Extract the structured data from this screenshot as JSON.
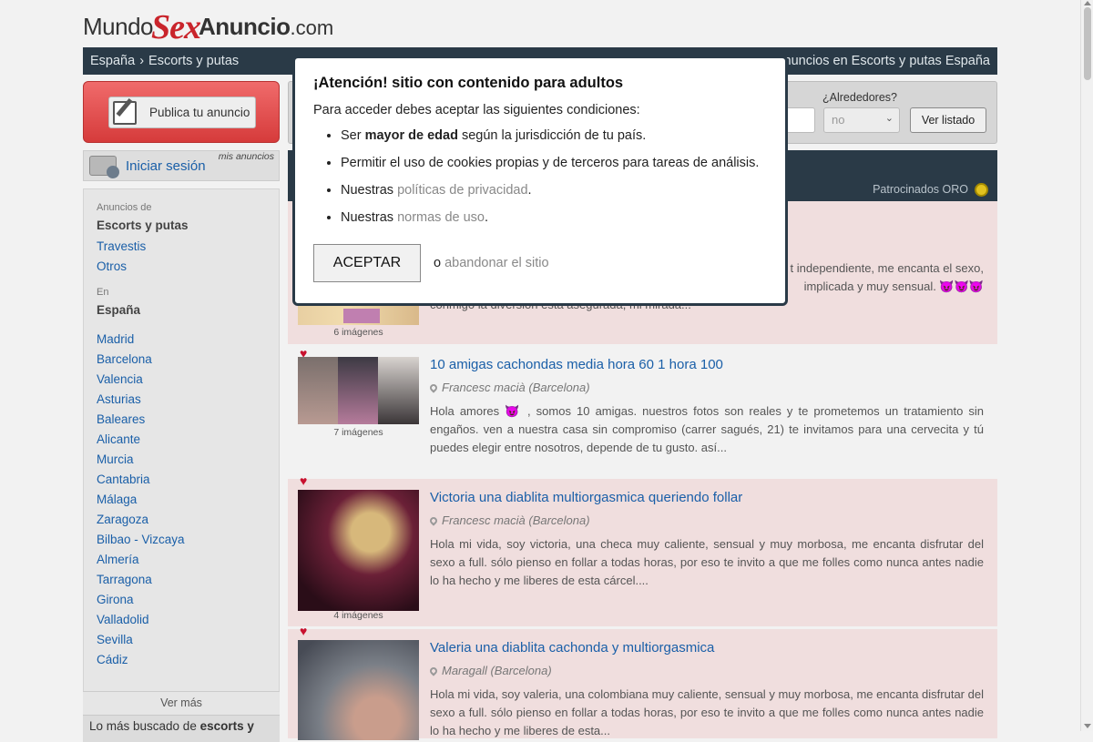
{
  "logo": {
    "part1": "Mundo",
    "part2": "Sex",
    "part3": "Anuncio",
    "part4": ".com"
  },
  "breadcrumb": {
    "home": "España",
    "sep": "›",
    "section": "Escorts y putas",
    "right": "Anuncios en Escorts y putas España"
  },
  "publish": {
    "label": "Publica tu anuncio"
  },
  "login": {
    "label": "Iniciar sesión",
    "mis": "mis anuncios"
  },
  "sidebar": {
    "anuncios_caption": "Anuncios de",
    "categories": [
      "Escorts y putas",
      "Travestis",
      "Otros"
    ],
    "en_caption": "En",
    "country": "España",
    "cities": [
      "Madrid",
      "Barcelona",
      "Valencia",
      "Asturias",
      "Baleares",
      "Alicante",
      "Murcia",
      "Cantabria",
      "Málaga",
      "Zaragoza",
      "Bilbao - Vizcaya",
      "Almería",
      "Tarragona",
      "Girona",
      "Valladolid",
      "Sevilla",
      "Cádiz"
    ],
    "ver_mas": "Ver más",
    "mas_buscado_prefix": "Lo más buscado de",
    "mas_buscado_strong": "escorts y"
  },
  "search": {
    "alrededores_label": "¿Alrededores?",
    "alrededores_value": "no",
    "ver_listado": "Ver listado"
  },
  "patrocinados": {
    "label": "Patrocinados ORO"
  },
  "listings": [
    {
      "title": "",
      "location": "",
      "desc_line1": "t independiente, me encanta el sexo,",
      "desc_line2": "implicada y muy sensual. 😈😈😈",
      "desc_line3": "conmigo la diversión está asegurada, mi mirada...",
      "images": "6 imágenes"
    },
    {
      "title": "10 amigas cachondas media hora 60 1 hora 100",
      "location": "Francesc macià (Barcelona)",
      "desc": "Hola amores 😈 , somos 10 amigas. nuestros fotos son reales y te prometemos un tratamiento sin engaños. ven a nuestra casa sin compromiso (carrer sagués, 21) te invitamos para una cervecita y tú puedes elegir entre nosotros, depende de tu gusto. así...",
      "images": "7 imágenes"
    },
    {
      "title": "Victoria una diablita multiorgasmica queriendo follar",
      "location": "Francesc macià (Barcelona)",
      "desc": "Hola mi vida, soy victoria, una checa muy caliente, sensual y muy morbosa, me encanta disfrutar del sexo a full. sólo pienso en follar a todas horas, por eso te invito a que me folles como nunca antes nadie lo ha hecho y me liberes de esta cárcel....",
      "images": "4 imágenes"
    },
    {
      "title": "Valeria una diablita cachonda y multiorgasmica",
      "location": "Maragall (Barcelona)",
      "desc": "Hola mi vida, soy valeria, una colombiana muy caliente, sensual y muy morbosa, me encanta disfrutar del sexo a full. sólo pienso en follar a todas horas, por eso te invito a que me folles como nunca antes nadie lo ha hecho y me liberes de esta..."
    }
  ],
  "modal": {
    "title": "¡Atención! sitio con contenido para adultos",
    "intro": "Para acceder debes aceptar las siguientes condiciones:",
    "c1_pre": "Ser ",
    "c1_strong": "mayor de edad",
    "c1_post": " según la jurisdicción de tu país.",
    "c2": "Permitir el uso de cookies propias y de terceros para tareas de análisis.",
    "c3_pre": "Nuestras ",
    "c3_link": "políticas de privacidad",
    "c3_post": ".",
    "c4_pre": "Nuestras ",
    "c4_link": "normas de uso",
    "c4_post": ".",
    "accept": "ACEPTAR",
    "or": "o",
    "leave": "abandonar el sitio"
  },
  "icons": {
    "publish": "edit-icon",
    "login": "user-card-icon",
    "location": "map-pin-icon",
    "favorite": "heart-icon",
    "gold": "gold-badge-icon"
  }
}
